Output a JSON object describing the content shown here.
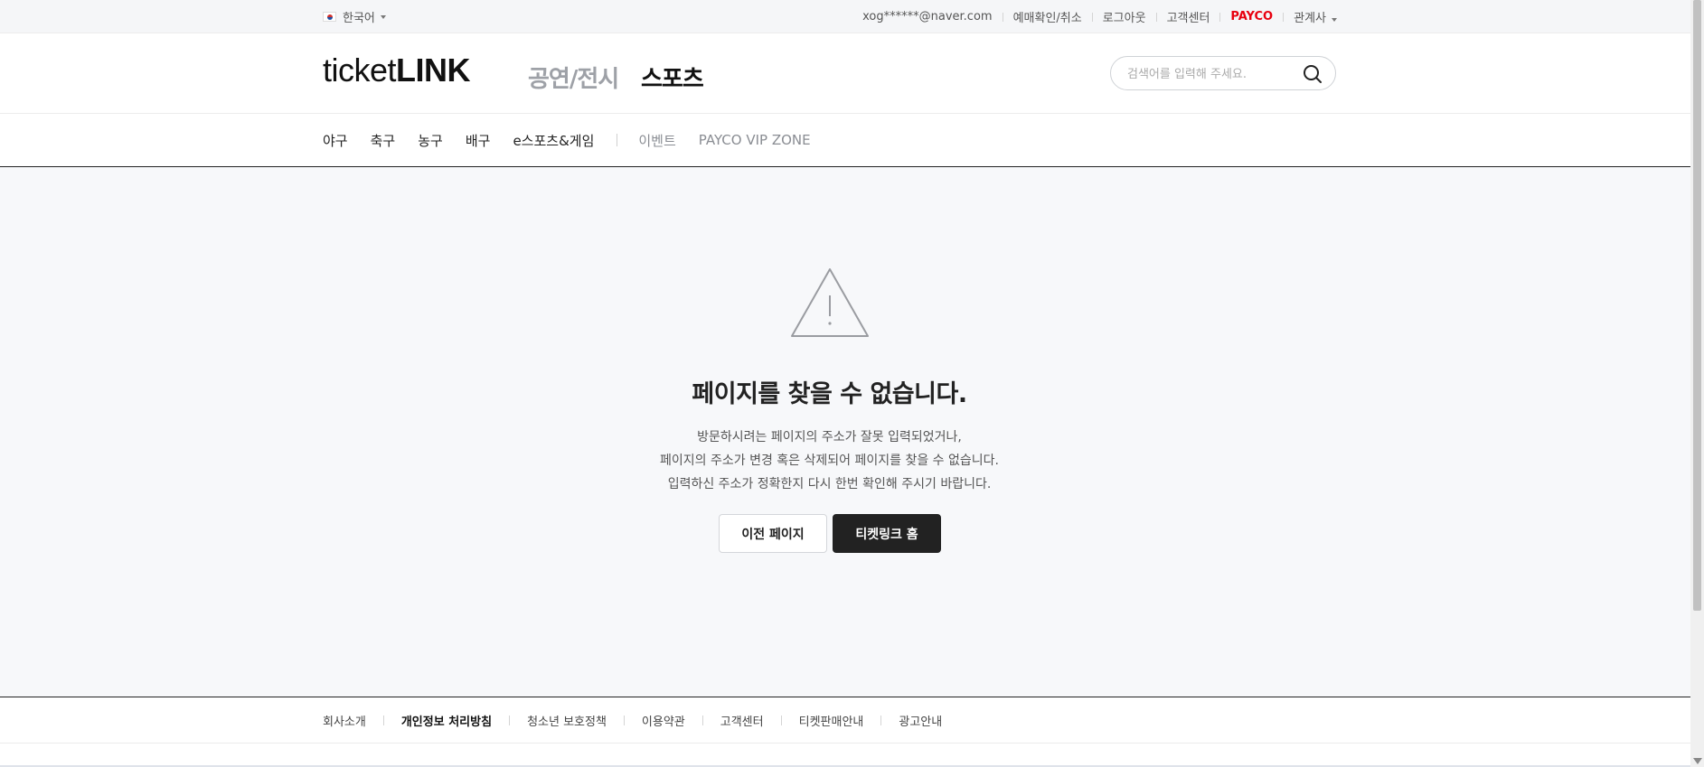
{
  "topbar": {
    "language": "한국어",
    "user_email": "xog******@naver.com",
    "links": [
      "예매확인/취소",
      "로그아웃",
      "고객센터"
    ],
    "payco": "PAYCO",
    "partner": "관계사"
  },
  "header": {
    "logo_light": "ticket",
    "logo_bold": "LINK",
    "category_performance": "공연/전시",
    "category_sports": "스포츠",
    "search_placeholder": "검색어를 입력해 주세요."
  },
  "nav": {
    "items": [
      "야구",
      "축구",
      "농구",
      "배구",
      "e스포츠&게임"
    ],
    "extra": [
      "이벤트",
      "PAYCO VIP ZONE"
    ]
  },
  "error": {
    "title": "페이지를 찾을 수 없습니다.",
    "lines": [
      "방문하시려는 페이지의 주소가 잘못 입력되었거나,",
      "페이지의 주소가 변경 혹은 삭제되어 페이지를 찾을 수 없습니다.",
      "입력하신 주소가 정확한지 다시 한번 확인해 주시기 바랍니다."
    ],
    "prev_button": "이전 페이지",
    "home_button": "티켓링크 홈"
  },
  "footer": {
    "links": [
      "회사소개",
      "개인정보 처리방침",
      "청소년 보호정책",
      "이용약관",
      "고객센터",
      "티켓판매안내",
      "광고안내"
    ]
  },
  "colors": {
    "payco_red": "#e8000f",
    "dark_button": "#222222",
    "page_background": "#f7f8fa"
  }
}
